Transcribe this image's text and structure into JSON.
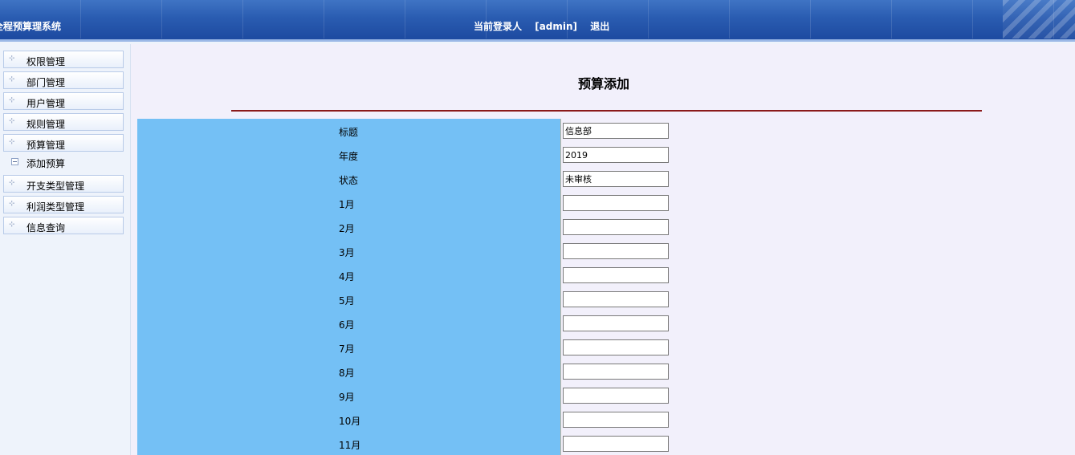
{
  "header": {
    "system_title": "全程预算理系统",
    "login_prefix": "当前登录人",
    "username": "[admin]",
    "logout": "退出"
  },
  "sidebar": {
    "items": [
      {
        "label": "权限管理"
      },
      {
        "label": "部门管理"
      },
      {
        "label": "用户管理"
      },
      {
        "label": "规则管理"
      },
      {
        "label": "预算管理"
      },
      {
        "label": "添加预算"
      },
      {
        "label": "开支类型管理"
      },
      {
        "label": "利润类型管理"
      },
      {
        "label": "信息查询"
      }
    ]
  },
  "main": {
    "title": "预算添加",
    "fields": [
      {
        "label": "标题",
        "value": ""
      },
      {
        "label": "年度",
        "value": "2019"
      },
      {
        "label": "状态",
        "value": "未审核"
      },
      {
        "label": "1月",
        "value": ""
      },
      {
        "label": "2月",
        "value": ""
      },
      {
        "label": "3月",
        "value": ""
      },
      {
        "label": "4月",
        "value": ""
      },
      {
        "label": "5月",
        "value": ""
      },
      {
        "label": "6月",
        "value": ""
      },
      {
        "label": "7月",
        "value": ""
      },
      {
        "label": "8月",
        "value": ""
      },
      {
        "label": "9月",
        "value": ""
      },
      {
        "label": "10月",
        "value": ""
      },
      {
        "label": "11月",
        "value": ""
      }
    ],
    "title_select_value": "信息部"
  }
}
